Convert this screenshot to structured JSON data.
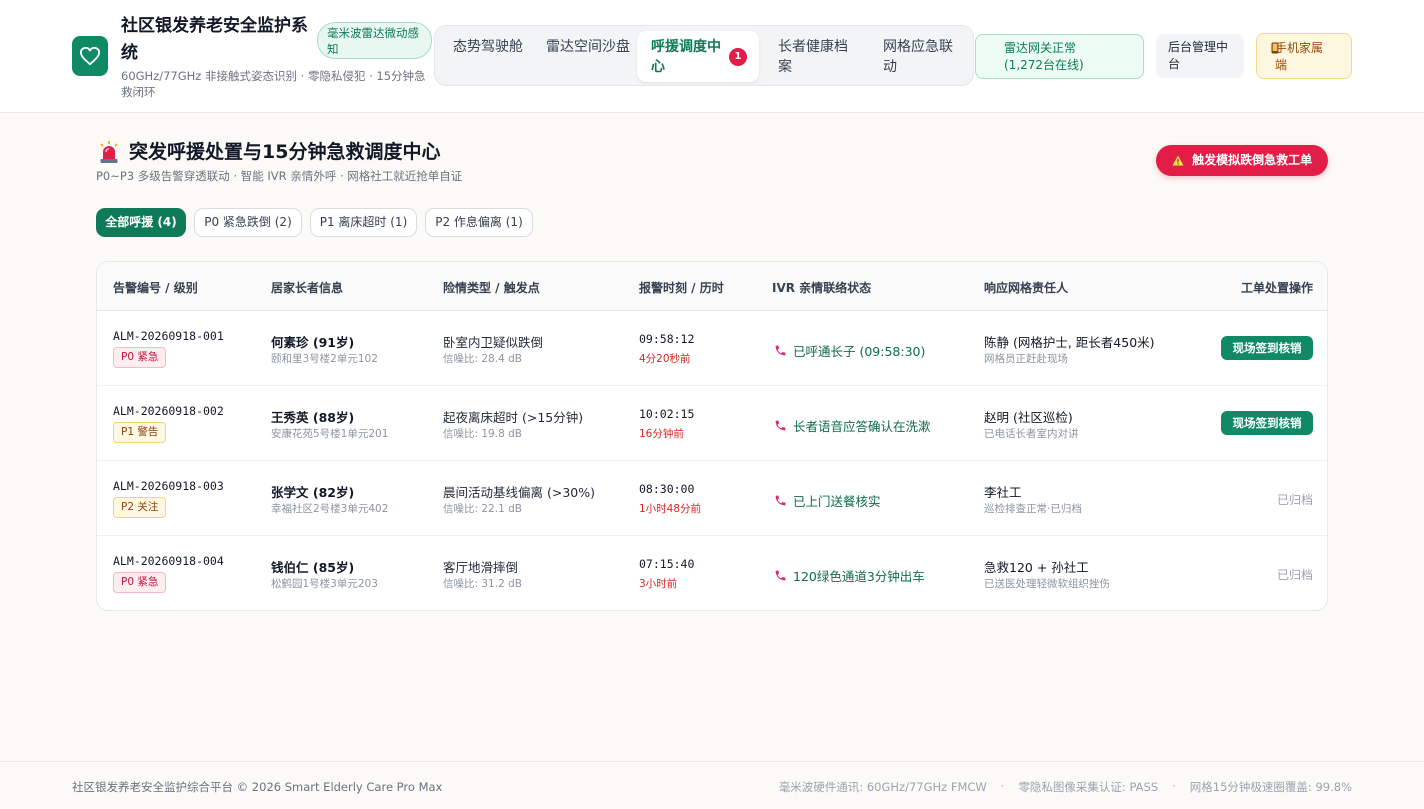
{
  "brand": {
    "title": "社区银发养老安全监护系统",
    "subtitle": "60GHz/77GHz 非接触式姿态识别 · 零隐私侵犯 · 15分钟急救闭环",
    "badge": "毫米波雷达微动感知",
    "logo_icon": "heart-icon"
  },
  "nav": {
    "tabs": [
      {
        "label": "态势驾驶舱"
      },
      {
        "label": "雷达空间沙盘"
      },
      {
        "label": "呼援调度中心",
        "active": true,
        "count": "1"
      },
      {
        "label": "长者健康档案"
      },
      {
        "label": "网格应急联动"
      }
    ]
  },
  "header_actions": {
    "gateway": "雷达网关正常 (1,272台在线)",
    "admin": "后台管理中台",
    "family": "手机家属端",
    "family_icon": "phone-icon"
  },
  "section": {
    "title": "突发呼援处置与15分钟急救调度中心",
    "subtitle": "P0~P3 多级告警穿透联动 · 智能 IVR 亲情外呼 · 网格社工就近抢单自证",
    "icon": "siren-icon",
    "trigger_button": "触发模拟跌倒急救工单",
    "trigger_icon": "warning-icon"
  },
  "filters": [
    {
      "label": "全部呼援 (4)",
      "active": true
    },
    {
      "label": "P0 紧急跌倒 (2)"
    },
    {
      "label": "P1 离床超时 (1)"
    },
    {
      "label": "P2 作息偏离 (1)"
    }
  ],
  "table": {
    "headers": [
      "告警编号 / 级别",
      "居家长者信息",
      "险情类型 / 触发点",
      "报警时刻 / 历时",
      "IVR 亲情联络状态",
      "响应网格责任人",
      "工单处置操作"
    ],
    "rows": [
      {
        "id": "ALM-20260918-001",
        "level": "P0 紧急",
        "level_class": "p0",
        "name": "何素珍 (91岁)",
        "address": "颐和里3号楼2单元102",
        "risk": "卧室内卫疑似跌倒",
        "snr": "信噪比: 28.4 dB",
        "time": "09:58:12",
        "ago": "4分20秒前",
        "ivr": "已呼通长子 (09:58:30)",
        "responder": "陈静 (网格护士, 距长者450米)",
        "responder_sub": "网格员正赶赴现场",
        "action": "现场签到核销",
        "action_type": "button"
      },
      {
        "id": "ALM-20260918-002",
        "level": "P1 警告",
        "level_class": "p1",
        "name": "王秀英 (88岁)",
        "address": "安康花苑5号楼1单元201",
        "risk": "起夜离床超时 (>15分钟)",
        "snr": "信噪比: 19.8 dB",
        "time": "10:02:15",
        "ago": "16分钟前",
        "ivr": "长者语音应答确认在洗漱",
        "responder": "赵明 (社区巡检)",
        "responder_sub": "已电话长者室内对讲",
        "action": "现场签到核销",
        "action_type": "button"
      },
      {
        "id": "ALM-20260918-003",
        "level": "P2 关注",
        "level_class": "p2",
        "name": "张学文 (82岁)",
        "address": "幸福社区2号楼3单元402",
        "risk": "晨间活动基线偏离 (>30%)",
        "snr": "信噪比: 22.1 dB",
        "time": "08:30:00",
        "ago": "1小时48分前",
        "ivr": "已上门送餐核实",
        "responder": "李社工",
        "responder_sub": "巡检排查正常·已归档",
        "action": "已归档",
        "action_type": "archived"
      },
      {
        "id": "ALM-20260918-004",
        "level": "P0 紧急",
        "level_class": "p0",
        "name": "钱伯仁 (85岁)",
        "address": "松鹤园1号楼3单元203",
        "risk": "客厅地滑摔倒",
        "snr": "信噪比: 31.2 dB",
        "time": "07:15:40",
        "ago": "3小时前",
        "ivr": "120绿色通道3分钟出车",
        "responder": "急救120 + 孙社工",
        "responder_sub": "已送医处理轻微软组织挫伤",
        "action": "已归档",
        "action_type": "archived"
      }
    ]
  },
  "footer": {
    "left": "社区银发养老安全监护综合平台 © 2026 Smart Elderly Care Pro Max",
    "right": [
      "毫米波硬件通讯: 60GHz/77GHz FMCW",
      "零隐私图像采集认证: PASS",
      "网格15分钟极速圈覆盖: 99.8%"
    ],
    "separator": "·"
  },
  "colors": {
    "brand": "#0f8a64",
    "alert": "#e11d48",
    "accent_text": "#0f7a57"
  }
}
